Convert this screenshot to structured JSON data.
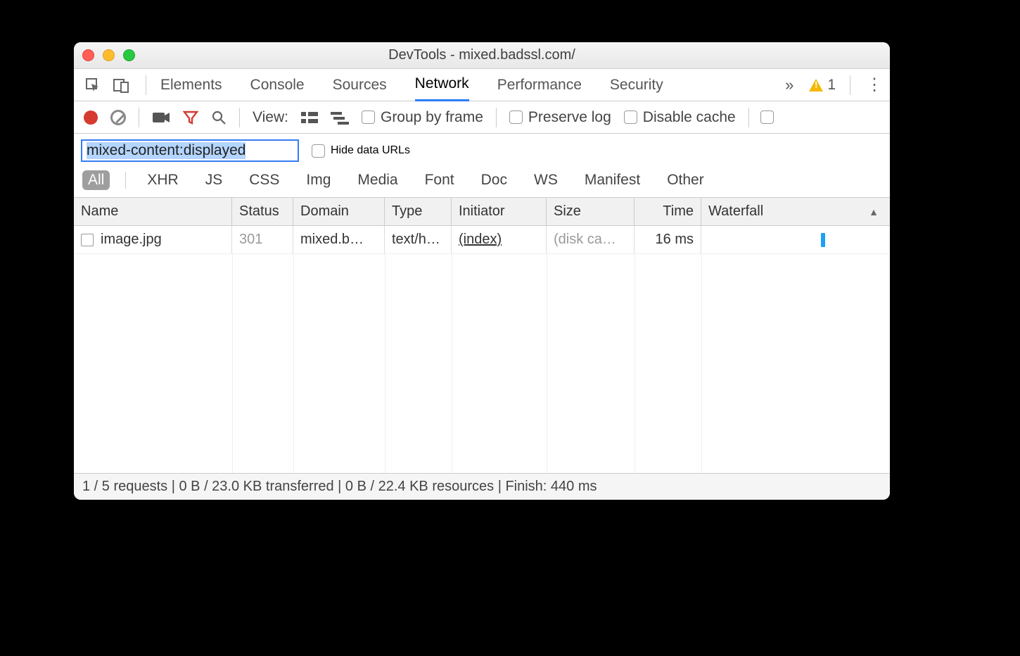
{
  "window": {
    "title": "DevTools - mixed.badssl.com/"
  },
  "tabs": {
    "items": [
      "Elements",
      "Console",
      "Sources",
      "Network",
      "Performance",
      "Security"
    ],
    "active": "Network",
    "overflow_glyph": "»",
    "warning_count": "1"
  },
  "toolbar": {
    "view_label": "View:",
    "group_by_frame": "Group by frame",
    "preserve_log": "Preserve log",
    "disable_cache": "Disable cache"
  },
  "filter": {
    "value": "mixed-content:displayed",
    "hide_data_urls": "Hide data URLs",
    "categories": [
      "All",
      "XHR",
      "JS",
      "CSS",
      "Img",
      "Media",
      "Font",
      "Doc",
      "WS",
      "Manifest",
      "Other"
    ],
    "active_category": "All"
  },
  "table": {
    "headers": {
      "name": "Name",
      "status": "Status",
      "domain": "Domain",
      "type": "Type",
      "initiator": "Initiator",
      "size": "Size",
      "time": "Time",
      "waterfall": "Waterfall"
    },
    "rows": [
      {
        "name": "image.jpg",
        "status": "301",
        "domain": "mixed.b…",
        "type": "text/h…",
        "initiator": "(index)",
        "size": "(disk ca…",
        "time": "16 ms"
      }
    ]
  },
  "statusbar": {
    "text": "1 / 5 requests | 0 B / 23.0 KB transferred | 0 B / 22.4 KB resources | Finish: 440 ms"
  }
}
